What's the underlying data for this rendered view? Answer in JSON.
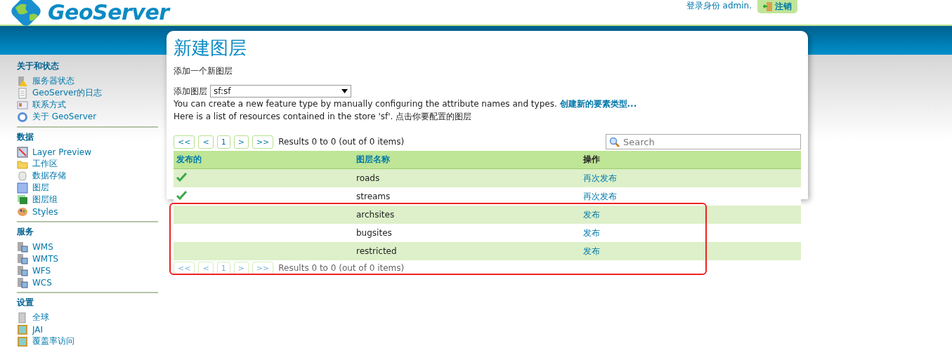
{
  "header": {
    "logo_text": "GeoServer",
    "login_text": "登录身份 admin.",
    "logout_button": "注销"
  },
  "sidebar": {
    "sections": [
      {
        "title": "关于和状态",
        "items": [
          "服务器状态",
          "GeoServer的日志",
          "联系方式",
          "关于 GeoServer"
        ]
      },
      {
        "title": "数据",
        "items": [
          "Layer Preview",
          "工作区",
          "数据存储",
          "图层",
          "图层组",
          "Styles"
        ]
      },
      {
        "title": "服务",
        "items": [
          "WMS",
          "WMTS",
          "WFS",
          "WCS"
        ]
      },
      {
        "title": "设置",
        "items": [
          "全球",
          "JAI",
          "覆盖率访问"
        ]
      }
    ]
  },
  "page": {
    "title": "新建图层",
    "subtitle": "添加一个新图层",
    "add_layer_label": "添加图层",
    "store_select": "sf:sf",
    "create_text": "You can create a new feature type by manually configuring the attribute names and types.",
    "create_link": "创建新的要素类型...",
    "list_text": "Here is a list of resources contained in the store 'sf'. 点击你要配置的图层",
    "pager": {
      "buttons": [
        "<<",
        "<",
        "1",
        ">",
        ">>"
      ],
      "results": "Results 0 to 0 (out of 0 items)"
    },
    "search": {
      "placeholder": "Search"
    },
    "table": {
      "columns": [
        "发布的",
        "图层名称",
        "操作"
      ],
      "rows": [
        {
          "published": true,
          "name": "roads",
          "action": "再次发布",
          "highlighted": false
        },
        {
          "published": true,
          "name": "streams",
          "action": "再次发布",
          "highlighted": false
        },
        {
          "published": false,
          "name": "archsites",
          "action": "发布",
          "highlighted": true
        },
        {
          "published": false,
          "name": "bugsites",
          "action": "发布",
          "highlighted": true
        },
        {
          "published": false,
          "name": "restricted",
          "action": "发布",
          "highlighted": true
        }
      ]
    },
    "bottom_pager": {
      "buttons": [
        "<<",
        "<",
        "1",
        ">",
        ">>"
      ],
      "results": "Results 0 to 0 (out of 0 items)"
    }
  }
}
